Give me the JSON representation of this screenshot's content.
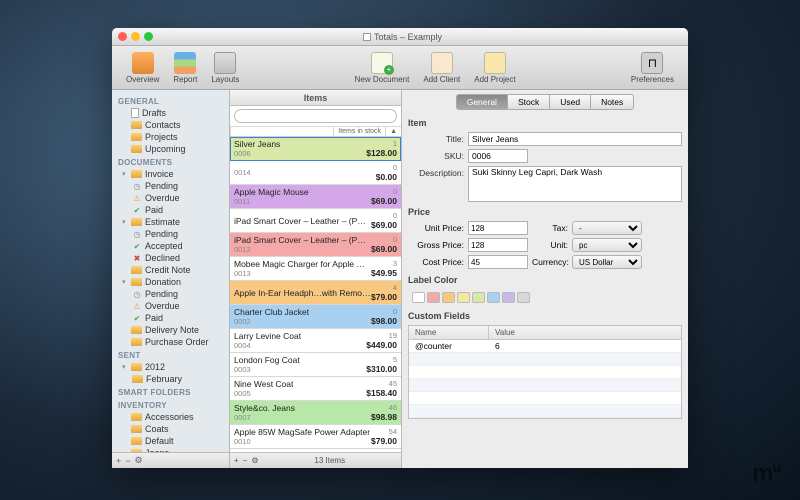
{
  "window": {
    "title": "Totals – Examply"
  },
  "toolbar": {
    "overview": "Overview",
    "report": "Report",
    "layouts": "Layouts",
    "new_document": "New Document",
    "add_client": "Add Client",
    "add_project": "Add Project",
    "preferences": "Preferences"
  },
  "sidebar": {
    "sections": [
      {
        "head": "GENERAL",
        "items": [
          {
            "label": "Drafts",
            "icon": "doc"
          },
          {
            "label": "Contacts",
            "icon": "folder"
          },
          {
            "label": "Projects",
            "icon": "folder"
          },
          {
            "label": "Upcoming",
            "icon": "folder"
          }
        ]
      },
      {
        "head": "DOCUMENTS",
        "items": [
          {
            "label": "Invoice",
            "icon": "folder",
            "expandable": true,
            "children": [
              {
                "label": "Pending",
                "status": "pending"
              },
              {
                "label": "Overdue",
                "status": "overdue"
              },
              {
                "label": "Paid",
                "status": "paid"
              }
            ]
          },
          {
            "label": "Estimate",
            "icon": "folder",
            "expandable": true,
            "children": [
              {
                "label": "Pending",
                "status": "pending"
              },
              {
                "label": "Accepted",
                "status": "accepted"
              },
              {
                "label": "Declined",
                "status": "declined"
              }
            ]
          },
          {
            "label": "Credit Note",
            "icon": "folder"
          },
          {
            "label": "Donation",
            "icon": "folder",
            "expandable": true,
            "children": [
              {
                "label": "Pending",
                "status": "pending"
              },
              {
                "label": "Overdue",
                "status": "overdue"
              },
              {
                "label": "Paid",
                "status": "paid"
              }
            ]
          },
          {
            "label": "Delivery Note",
            "icon": "folder"
          },
          {
            "label": "Purchase Order",
            "icon": "folder"
          }
        ]
      },
      {
        "head": "SENT",
        "items": [
          {
            "label": "2012",
            "icon": "folder",
            "expandable": true,
            "children": [
              {
                "label": "February",
                "icon": "folder"
              }
            ]
          }
        ]
      },
      {
        "head": "SMART FOLDERS",
        "items": []
      },
      {
        "head": "INVENTORY",
        "items": [
          {
            "label": "Accessories",
            "icon": "folder"
          },
          {
            "label": "Coats",
            "icon": "folder"
          },
          {
            "label": "Default",
            "icon": "folder"
          },
          {
            "label": "Jeans",
            "icon": "folder"
          }
        ]
      }
    ],
    "footer": {
      "add": "+",
      "remove": "−",
      "gear": "⚙"
    }
  },
  "items_pane": {
    "title": "Items",
    "search_placeholder": "",
    "col_stock": "Items in stock",
    "col_sort": "▲",
    "rows": [
      {
        "name": "Silver Jeans",
        "sku": "0006",
        "stock": "1",
        "price": "$128.00",
        "color": "#d7e8a8",
        "selected": true
      },
      {
        "name": "",
        "sku": "0014",
        "stock": "0",
        "price": "$0.00",
        "color": "#ffffff"
      },
      {
        "name": "Apple Magic Mouse",
        "sku": "0011",
        "stock": "0",
        "price": "$69.00",
        "color": "#d4a8e8"
      },
      {
        "name": "iPad Smart Cover – Leather – (PRODUCT) RED",
        "sku": "",
        "stock": "0",
        "price": "$69.00",
        "color": "#ffffff"
      },
      {
        "name": "iPad Smart Cover – Leather – (PRODUCT) RED",
        "sku": "0012",
        "stock": "0",
        "price": "$69.00",
        "color": "#f4a8a8"
      },
      {
        "name": "Mobee Magic Charger for Apple Magic Mouse",
        "sku": "0013",
        "stock": "3",
        "price": "$49.95",
        "color": "#ffffff"
      },
      {
        "name": "Apple In-Ear Headph…with Remote and Mic",
        "sku": "",
        "stock": "4",
        "price": "$79.00",
        "color": "#f8c880"
      },
      {
        "name": "Charter Club Jacket",
        "sku": "0002",
        "stock": "0",
        "price": "$98.00",
        "color": "#a8d0f0"
      },
      {
        "name": "Larry Levine Coat",
        "sku": "0004",
        "stock": "19",
        "price": "$449.00",
        "color": "#ffffff"
      },
      {
        "name": "London Fog Coat",
        "sku": "0003",
        "stock": "5",
        "price": "$310.00",
        "color": "#ffffff"
      },
      {
        "name": "Nine West Coat",
        "sku": "0005",
        "stock": "45",
        "price": "$158.40",
        "color": "#ffffff"
      },
      {
        "name": "Style&co. Jeans",
        "sku": "0007",
        "stock": "46",
        "price": "$98.98",
        "color": "#b8e8a8"
      },
      {
        "name": "Apple 85W MagSafe Power Adapter",
        "sku": "0010",
        "stock": "54",
        "price": "$79.00",
        "color": "#ffffff"
      }
    ],
    "footer": {
      "add": "+",
      "remove": "−",
      "gear": "⚙",
      "count": "13 Items"
    }
  },
  "detail": {
    "tabs": [
      "General",
      "Stock",
      "Used",
      "Notes"
    ],
    "active_tab": 0,
    "item_section": "Item",
    "title_label": "Title:",
    "title_value": "Silver Jeans",
    "sku_label": "SKU:",
    "sku_value": "0006",
    "desc_label": "Description:",
    "desc_value": "Suki Skinny Leg Capri, Dark Wash",
    "price_section": "Price",
    "unit_price_label": "Unit Price:",
    "unit_price_value": "128",
    "gross_price_label": "Gross Price:",
    "gross_price_value": "128",
    "cost_price_label": "Cost Price:",
    "cost_price_value": "45",
    "tax_label": "Tax:",
    "tax_value": "-",
    "unit_label": "Unit:",
    "unit_value": "pc",
    "currency_label": "Currency:",
    "currency_value": "US Dollar",
    "label_color_section": "Label Color",
    "colors": [
      "#ffffff",
      "#f4a8a8",
      "#f8c880",
      "#f4e8a0",
      "#d7e8a8",
      "#a8d0f0",
      "#c8b8e8",
      "#d8d8d8"
    ],
    "custom_fields_section": "Custom Fields",
    "cf_name_col": "Name",
    "cf_value_col": "Value",
    "custom_fields": [
      {
        "name": "@counter",
        "value": "6"
      }
    ]
  }
}
